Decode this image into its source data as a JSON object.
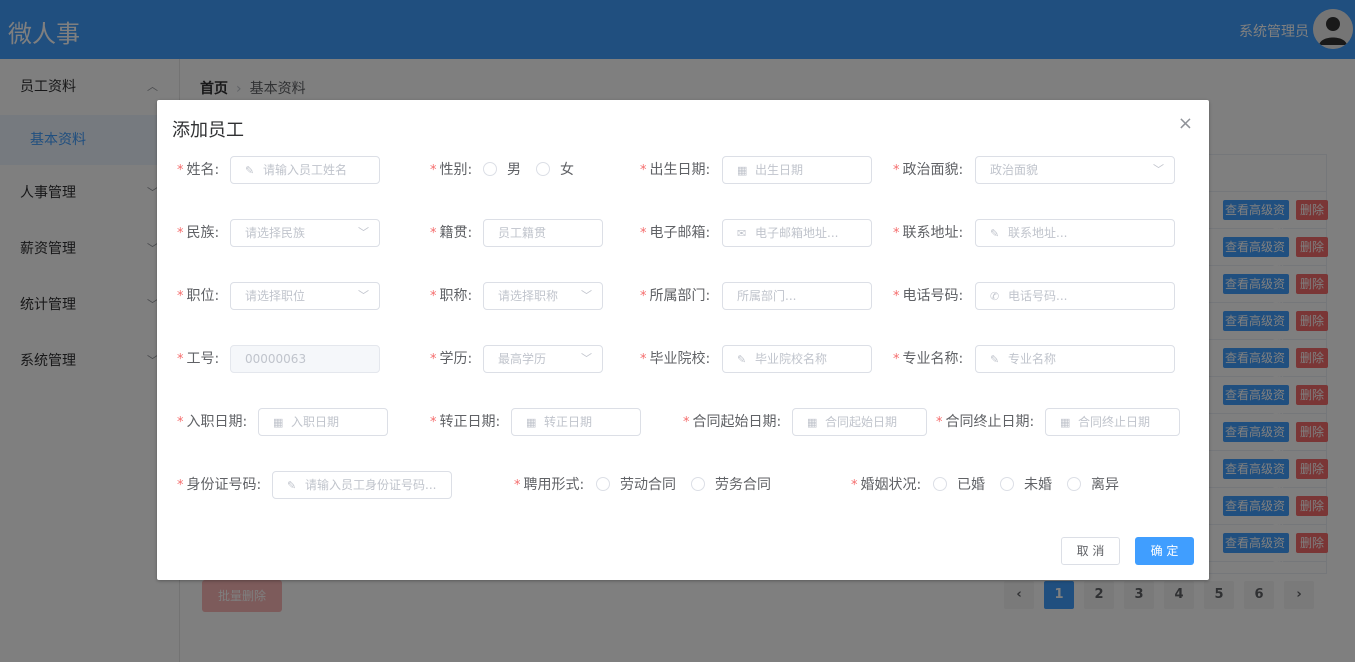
{
  "header": {
    "app_title": "微人事",
    "user_name": "系统管理员",
    "accent": "#409eff"
  },
  "sidebar": {
    "items": [
      {
        "label": "员工资料"
      },
      {
        "label": "人事管理"
      },
      {
        "label": "薪资管理"
      },
      {
        "label": "统计管理"
      },
      {
        "label": "系统管理"
      }
    ],
    "sub_item": "基本资料"
  },
  "breadcrumb": {
    "home": "首页",
    "current": "基本资料"
  },
  "table": {
    "adv_label": "查看高级资料",
    "del_label": "删除"
  },
  "batch_delete": "批量删除",
  "pagination": {
    "pages": [
      "1",
      "2",
      "3",
      "4",
      "5",
      "6"
    ],
    "current": "1",
    "prev": "‹",
    "next": "›"
  },
  "dialog": {
    "title": "添加员工",
    "close": "×",
    "fields": {
      "name": {
        "label": "姓名:",
        "placeholder": "请输入员工姓名"
      },
      "gender": {
        "label": "性别:",
        "options": [
          "男",
          "女"
        ]
      },
      "birthday": {
        "label": "出生日期:",
        "placeholder": "出生日期"
      },
      "politic": {
        "label": "政治面貌:",
        "placeholder": "政治面貌"
      },
      "nation": {
        "label": "民族:",
        "placeholder": "请选择民族"
      },
      "native": {
        "label": "籍贯:",
        "placeholder": "员工籍贯"
      },
      "email": {
        "label": "电子邮箱:",
        "placeholder": "电子邮箱地址..."
      },
      "address": {
        "label": "联系地址:",
        "placeholder": "联系地址..."
      },
      "position": {
        "label": "职位:",
        "placeholder": "请选择职位"
      },
      "jobtitle": {
        "label": "职称:",
        "placeholder": "请选择职称"
      },
      "dept": {
        "label": "所属部门:",
        "placeholder": "所属部门..."
      },
      "phone": {
        "label": "电话号码:",
        "placeholder": "电话号码..."
      },
      "workid": {
        "label": "工号:",
        "value": "00000063"
      },
      "degree": {
        "label": "学历:",
        "placeholder": "最高学历"
      },
      "school": {
        "label": "毕业院校:",
        "placeholder": "毕业院校名称"
      },
      "specialty": {
        "label": "专业名称:",
        "placeholder": "专业名称"
      },
      "begin_date": {
        "label": "入职日期:",
        "placeholder": "入职日期"
      },
      "conversion": {
        "label": "转正日期:",
        "placeholder": "转正日期"
      },
      "contract_begin": {
        "label": "合同起始日期:",
        "placeholder": "合同起始日期"
      },
      "contract_end": {
        "label": "合同终止日期:",
        "placeholder": "合同终止日期"
      },
      "idcard": {
        "label": "身份证号码:",
        "placeholder": "请输入员工身份证号码..."
      },
      "engage": {
        "label": "聘用形式:",
        "options": [
          "劳动合同",
          "劳务合同"
        ]
      },
      "wedlock": {
        "label": "婚姻状况:",
        "options": [
          "已婚",
          "未婚",
          "离异"
        ]
      }
    },
    "cancel": "取 消",
    "ok": "确 定"
  }
}
